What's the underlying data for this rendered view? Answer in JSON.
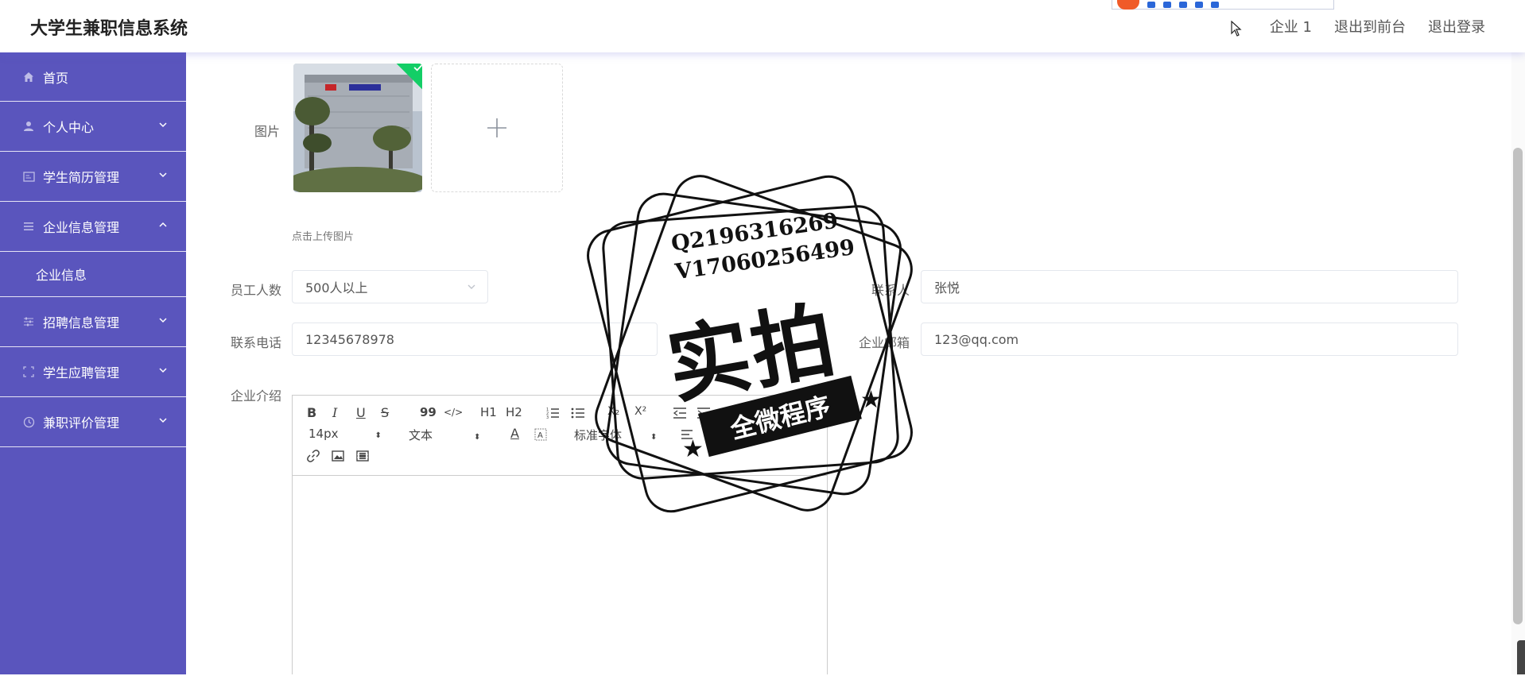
{
  "app": {
    "title": "大学生兼职信息系统"
  },
  "header": {
    "user_label": "企业 1",
    "front_label": "退出到前台",
    "logout_label": "退出登录"
  },
  "sidebar": {
    "items": [
      {
        "label": "首页",
        "icon": "home-icon"
      },
      {
        "label": "个人中心",
        "icon": "user-icon"
      },
      {
        "label": "学生简历管理",
        "icon": "resume-icon"
      },
      {
        "label": "企业信息管理",
        "icon": "list-icon",
        "expanded": true
      },
      {
        "label": "企业信息"
      },
      {
        "label": "招聘信息管理",
        "icon": "sliders-icon"
      },
      {
        "label": "学生应聘管理",
        "icon": "fullscreen-icon"
      },
      {
        "label": "兼职评价管理",
        "icon": "clock-icon"
      }
    ]
  },
  "form": {
    "image_label": "图片",
    "upload_hint": "点击上传图片",
    "employees_label": "员工人数",
    "employees_value": "500人以上",
    "contact_label": "联系人",
    "contact_value": "张悦",
    "phone_label": "联系电话",
    "phone_value": "12345678978",
    "email_label": "企业邮箱",
    "email_value": "123@qq.com",
    "intro_label": "企业介绍"
  },
  "editor": {
    "font_size": "14px",
    "block_type": "文本",
    "font_family": "标准字体",
    "buttons": {
      "bold": "B",
      "italic": "I",
      "underline": "U",
      "strike": "S",
      "quote": "99",
      "code": "</>",
      "h1": "H1",
      "h2": "H2",
      "sub": "X₂",
      "sup": "X²",
      "color": "A"
    }
  },
  "watermark": {
    "line1": "Q2196316269",
    "line2": "V17060256499",
    "big": "实拍",
    "ribbon": "全微程序"
  },
  "colors": {
    "sidebar": "#5a55bd",
    "success": "#13ce66"
  }
}
